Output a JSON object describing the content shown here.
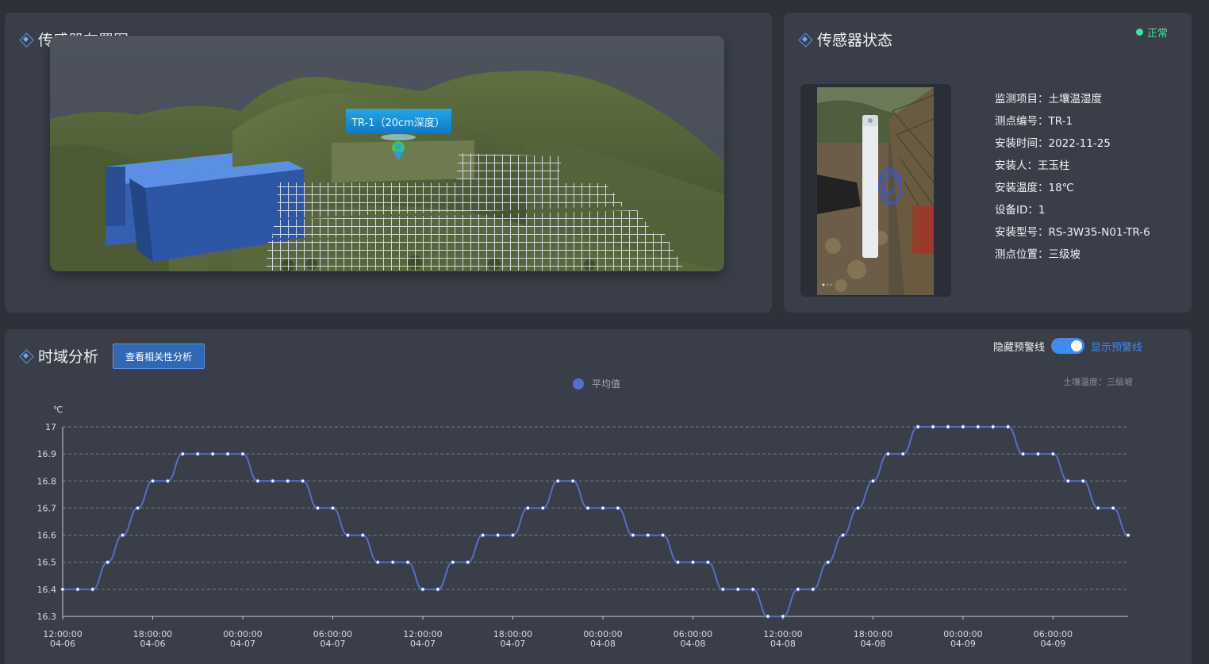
{
  "layout_panel": {
    "title": "传感器布置图",
    "marker_label": "TR-1（20cm深度）"
  },
  "status_panel": {
    "title": "传感器状态",
    "status": "正常",
    "colors": {
      "status": "#3fe3a3"
    },
    "info": [
      {
        "key": "监测项目：",
        "value": "土壤温湿度"
      },
      {
        "key": "测点编号：",
        "value": "TR-1"
      },
      {
        "key": "安装时间：",
        "value": "2022-11-25"
      },
      {
        "key": "安装人：",
        "value": "王玉柱"
      },
      {
        "key": "安装温度：",
        "value": "18℃"
      },
      {
        "key": "设备ID：",
        "value": "1"
      },
      {
        "key": "安装型号：",
        "value": "RS-3W35-N01-TR-6"
      },
      {
        "key": "测点位置：",
        "value": "三级坡"
      }
    ]
  },
  "time_panel": {
    "title": "时域分析",
    "correlation_button": "查看相关性分析",
    "toggle_off_label": "隐藏预警线",
    "toggle_on_label": "显示预警线",
    "toggle_state": "on",
    "chart_subtitle": "土壤温度：三级坡"
  },
  "chart_data": {
    "type": "line",
    "ylabel": "℃",
    "ylim": [
      16.3,
      17.0
    ],
    "yticks": [
      16.3,
      16.4,
      16.5,
      16.6,
      16.7,
      16.8,
      16.9,
      17
    ],
    "grid": true,
    "legend_position": "top-center",
    "x_tick_labels": [
      [
        "12:00:00",
        "04-06"
      ],
      [
        "18:00:00",
        "04-06"
      ],
      [
        "00:00:00",
        "04-07"
      ],
      [
        "06:00:00",
        "04-07"
      ],
      [
        "12:00:00",
        "04-07"
      ],
      [
        "18:00:00",
        "04-07"
      ],
      [
        "00:00:00",
        "04-08"
      ],
      [
        "06:00:00",
        "04-08"
      ],
      [
        "12:00:00",
        "04-08"
      ],
      [
        "18:00:00",
        "04-08"
      ],
      [
        "00:00:00",
        "04-09"
      ],
      [
        "06:00:00",
        "04-09"
      ]
    ],
    "x_start": "2023-04-06 12:00",
    "x_step_hours": 1,
    "series": [
      {
        "name": "平均值",
        "color": "#5470c6",
        "values": [
          16.4,
          16.4,
          16.4,
          16.5,
          16.6,
          16.7,
          16.8,
          16.8,
          16.9,
          16.9,
          16.9,
          16.9,
          16.9,
          16.8,
          16.8,
          16.8,
          16.8,
          16.7,
          16.7,
          16.6,
          16.6,
          16.5,
          16.5,
          16.5,
          16.4,
          16.4,
          16.5,
          16.5,
          16.6,
          16.6,
          16.6,
          16.7,
          16.7,
          16.8,
          16.8,
          16.7,
          16.7,
          16.7,
          16.6,
          16.6,
          16.6,
          16.5,
          16.5,
          16.5,
          16.4,
          16.4,
          16.4,
          16.3,
          16.3,
          16.4,
          16.4,
          16.5,
          16.6,
          16.7,
          16.8,
          16.9,
          16.9,
          17.0,
          17.0,
          17.0,
          17.0,
          17.0,
          17.0,
          17.0,
          16.9,
          16.9,
          16.9,
          16.8,
          16.8,
          16.7,
          16.7,
          16.6
        ]
      }
    ]
  }
}
